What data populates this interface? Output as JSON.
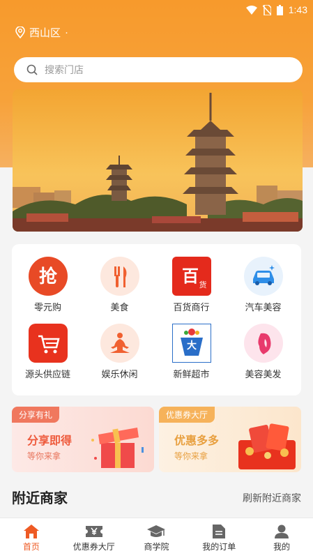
{
  "status": {
    "time": "1:43"
  },
  "location": {
    "city": "西山区",
    "suffix": "·"
  },
  "search": {
    "placeholder": "搜索门店"
  },
  "categories": [
    {
      "label": "零元购",
      "icon": "grab-icon",
      "glyph": "抢"
    },
    {
      "label": "美食",
      "icon": "fork-knife-icon"
    },
    {
      "label": "百货商行",
      "icon": "department-store-icon",
      "glyph": "百",
      "glyph_small": "货"
    },
    {
      "label": "汽车美容",
      "icon": "car-icon"
    },
    {
      "label": "源头供应链",
      "icon": "cart-icon"
    },
    {
      "label": "娱乐休闲",
      "icon": "meditation-icon"
    },
    {
      "label": "新鲜超市",
      "icon": "supermarket-icon",
      "glyph": "大"
    },
    {
      "label": "美容美发",
      "icon": "beauty-icon"
    }
  ],
  "promos": [
    {
      "tag": "分享有礼",
      "title": "分享即得",
      "subtitle": "等你来拿",
      "icon": "gift-box-icon"
    },
    {
      "tag": "优惠券大厅",
      "title": "优惠多多",
      "subtitle": "等你来拿",
      "icon": "red-envelope-icon"
    }
  ],
  "nearby": {
    "title": "附近商家",
    "refresh": "刷新附近商家"
  },
  "tabs": [
    {
      "label": "首页",
      "icon": "home-icon",
      "active": true
    },
    {
      "label": "优惠券大厅",
      "icon": "coupon-icon"
    },
    {
      "label": "商学院",
      "icon": "graduation-cap-icon"
    },
    {
      "label": "我的订单",
      "icon": "order-icon"
    },
    {
      "label": "我的",
      "icon": "user-icon"
    }
  ],
  "colors": {
    "brand": "#f79a2c",
    "accent": "#ee5a24",
    "red": "#e8321e"
  }
}
